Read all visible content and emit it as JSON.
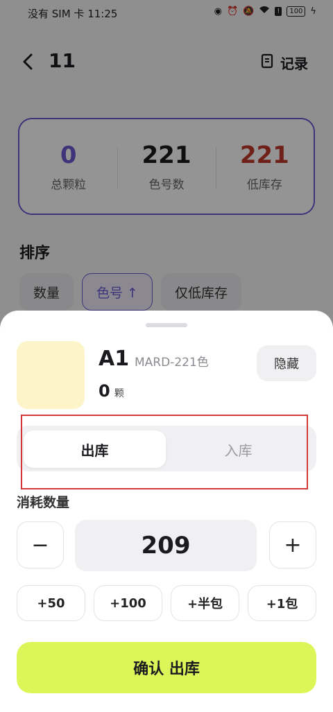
{
  "status_bar": {
    "carrier": "没有 SIM 卡",
    "time": "11:25",
    "battery": "100"
  },
  "header": {
    "title": "11",
    "record_label": "记录"
  },
  "stats": [
    {
      "value": "0",
      "label": "总颗粒",
      "color": "#6c5bd0"
    },
    {
      "value": "221",
      "label": "色号数",
      "color": "#1b1b1f"
    },
    {
      "value": "221",
      "label": "低库存",
      "color": "#c0392b"
    }
  ],
  "sort": {
    "title": "排序",
    "chips": [
      "数量",
      "色号 ↑",
      "仅低库存"
    ]
  },
  "sheet": {
    "color_code": "A1",
    "color_set": "MARD-221色",
    "count_value": "0",
    "count_unit": "颗",
    "swatch_color": "#fdf5c9",
    "hide_label": "隐藏",
    "tabs": {
      "out_label": "出库",
      "in_label": "入库"
    },
    "quantity_label": "消耗数量",
    "quantity_value": "209",
    "minus_label": "−",
    "plus_label": "+",
    "quick_adds": [
      "+50",
      "+100",
      "+半包",
      "+1包"
    ],
    "confirm_label": "确认 出库"
  },
  "colors": {
    "accent": "#6c5bd0",
    "confirm": "#dcf65a",
    "low_stock": "#c0392b"
  }
}
